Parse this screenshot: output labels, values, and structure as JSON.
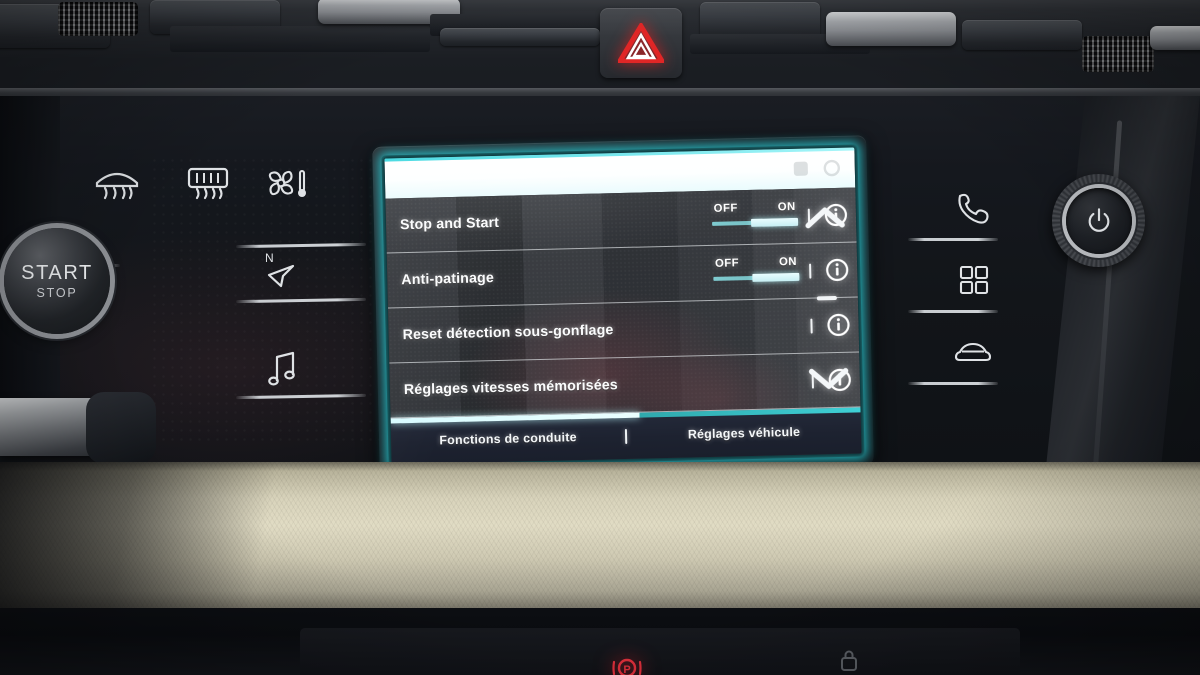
{
  "scene": {
    "title": "Peugeot i-Cockpit infotainment touchscreen — driving functions menu"
  },
  "screen": {
    "status_bar": {
      "icons": [
        "app-icon",
        "clock-icon"
      ]
    },
    "rows": [
      {
        "label": "Stop and Start",
        "has_toggle": true,
        "toggle": {
          "off_label": "OFF",
          "on_label": "ON",
          "value": "ON"
        },
        "info_icon": "info-icon"
      },
      {
        "label": "Anti-patinage",
        "has_toggle": true,
        "toggle": {
          "off_label": "OFF",
          "on_label": "ON",
          "value": "ON"
        },
        "info_icon": "info-icon"
      },
      {
        "label": "Reset détection sous-gonflage",
        "has_toggle": false,
        "info_icon": "info-icon"
      },
      {
        "label": "Réglages vitesses mémorisées",
        "has_toggle": false,
        "info_icon": "info-icon"
      }
    ],
    "scroll_rail": {
      "up_icon": "chevron-up-icon",
      "thumb_icon": "scroll-thumb-dash",
      "down_icon": "chevron-down-icon"
    },
    "tabs": [
      {
        "label": "Fonctions de conduite",
        "active": true
      },
      {
        "label": "Réglages véhicule",
        "active": false
      }
    ],
    "colors": {
      "accent_cyan": "#3fd0d6",
      "glow_cyan": "#28e1eb",
      "tabbar_bg": "#1d2230",
      "list_bg": "#3c3f44",
      "text": "#fbfcfd"
    }
  },
  "console": {
    "start_button": {
      "line1": "START",
      "line2": "STOP"
    },
    "left_buttons": [
      {
        "icon": "windscreen-defrost-icon"
      },
      {
        "icon": "rear-defrost-icon"
      },
      {
        "icon": "climate-fan-icon"
      },
      {
        "icon": "navigation-icon"
      },
      {
        "icon": "media-music-icon"
      }
    ],
    "right_buttons": [
      {
        "icon": "phone-icon"
      },
      {
        "icon": "apps-grid-icon"
      },
      {
        "icon": "vehicle-car-icon"
      }
    ],
    "power_knob": {
      "icon": "power-icon"
    },
    "hazard_button": {
      "icon": "hazard-triangle-icon",
      "color": "#d82222"
    }
  },
  "lower_panel": {
    "brake_warning": {
      "icon": "parking-brake-icon",
      "color": "#d2202c"
    },
    "lock_indicator": {
      "icon": "lock-icon"
    }
  }
}
